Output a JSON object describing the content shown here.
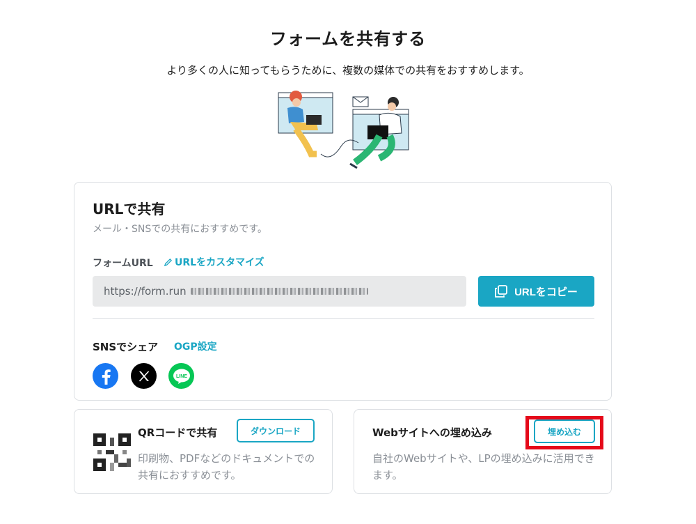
{
  "header": {
    "title": "フォームを共有する",
    "subtitle": "より多くの人に知ってもらうために、複数の媒体での共有をおすすめします。"
  },
  "url_share": {
    "title": "URLで共有",
    "description": "メール・SNSでの共有におすすめです。",
    "field_label": "フォームURL",
    "customize_label": "URLをカスタマイズ",
    "url_prefix": "https://form.run",
    "copy_label": "URLをコピー",
    "sns_label": "SNSでシェア",
    "ogp_label": "OGP設定",
    "sns_icons": [
      "facebook-icon",
      "x-icon",
      "line-icon"
    ],
    "line_text": "LINE"
  },
  "qr_share": {
    "title": "QRコードで共有",
    "download_label": "ダウンロード",
    "description": "印刷物、PDFなどのドキュメントでの共有におすすめです。"
  },
  "web_embed": {
    "title": "Webサイトへの埋め込み",
    "embed_label": "埋め込む",
    "description": "自社のWebサイトや、LPの埋め込みに活用できます。"
  },
  "colors": {
    "accent": "#1aa6c4",
    "highlight": "#e5091a",
    "facebook": "#1877f2",
    "line": "#06c755"
  }
}
